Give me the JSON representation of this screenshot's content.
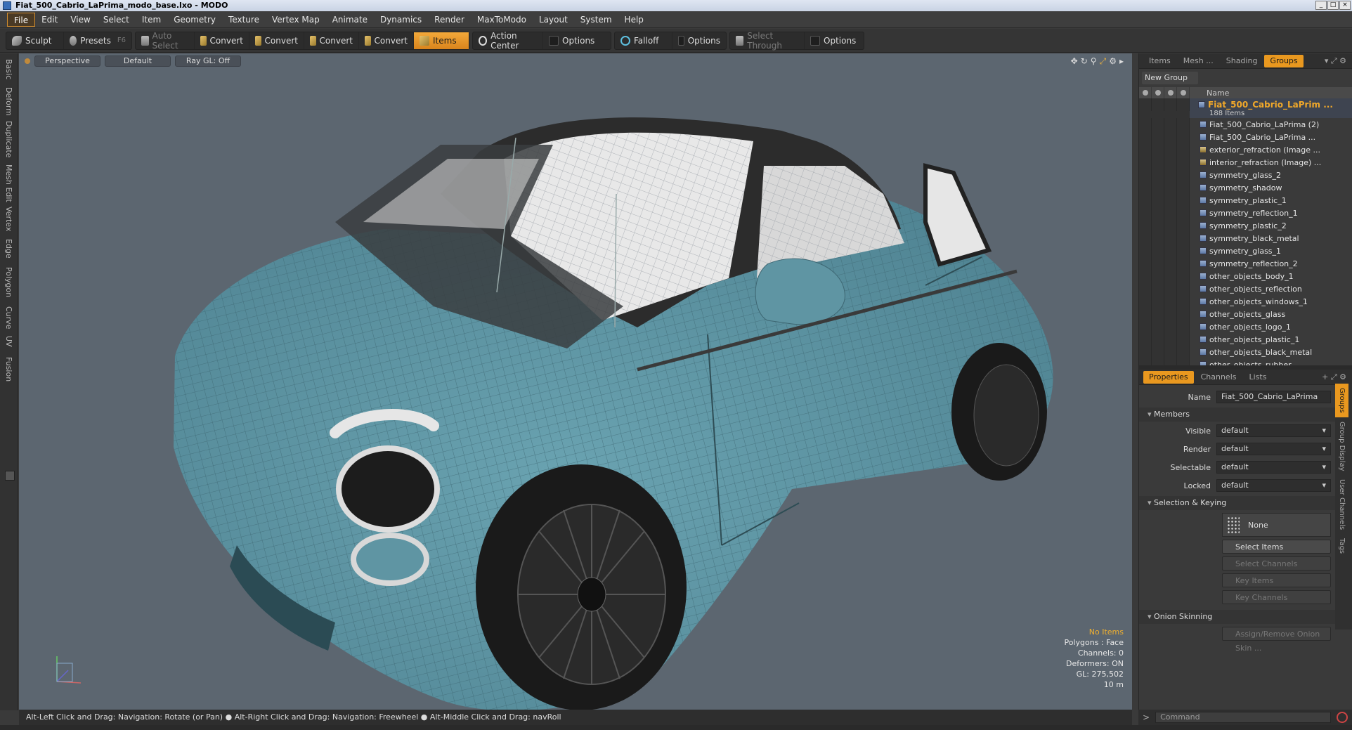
{
  "window": {
    "title": "Fiat_500_Cabrio_LaPrima_modo_base.lxo - MODO"
  },
  "menu": [
    "File",
    "Edit",
    "View",
    "Select",
    "Item",
    "Geometry",
    "Texture",
    "Vertex Map",
    "Animate",
    "Dynamics",
    "Render",
    "MaxToModo",
    "Layout",
    "System",
    "Help"
  ],
  "toolbar": {
    "sculpt": "Sculpt",
    "presets": "Presets",
    "presets_shortcut": "F6",
    "auto_select": "Auto Select",
    "convert1": "Convert",
    "convert2": "Convert",
    "convert3": "Convert",
    "convert4": "Convert",
    "items": "Items",
    "action_center": "Action Center",
    "options1": "Options",
    "falloff": "Falloff",
    "options2": "Options",
    "select_through": "Select Through",
    "options3": "Options"
  },
  "left_tabs": [
    "Basic",
    "Deform",
    "Duplicate",
    "Mesh Edit",
    "Vertex",
    "Edge",
    "Polygon",
    "Curve",
    "UV",
    "Fusion"
  ],
  "viewport": {
    "view": "Perspective",
    "shading": "Default",
    "raygl": "Ray GL: Off",
    "stats": {
      "items": "No Items",
      "polygons": "Polygons : Face",
      "channels": "Channels: 0",
      "deformers": "Deformers: ON",
      "gl": "GL: 275,502",
      "scale": "10 m"
    }
  },
  "status": "Alt-Left Click and Drag: Navigation: Rotate (or Pan) ● Alt-Right Click and Drag: Navigation: Freewheel ● Alt-Middle Click and Drag: navRoll",
  "panel_top": {
    "tabs": [
      "Items",
      "Mesh ...",
      "Shading",
      "Groups"
    ],
    "active_tab": "Groups",
    "new_group": "New Group",
    "name_header": "Name",
    "group": {
      "name": "Fiat_500_Cabrio_LaPrim ...",
      "count": "188 Items"
    },
    "items": [
      "Fiat_500_Cabrio_LaPrima (2)",
      "Fiat_500_Cabrio_LaPrima ...",
      "exterior_refraction (Image ...",
      "interior_refraction (Image) ...",
      "symmetry_glass_2",
      "symmetry_shadow",
      "symmetry_plastic_1",
      "symmetry_reflection_1",
      "symmetry_plastic_2",
      "symmetry_black_metal",
      "symmetry_glass_1",
      "symmetry_reflection_2",
      "other_objects_body_1",
      "other_objects_reflection",
      "other_objects_windows_1",
      "other_objects_glass",
      "other_objects_logo_1",
      "other_objects_plastic_1",
      "other_objects_black_metal",
      "other_objects_rubber"
    ]
  },
  "panel_props": {
    "tabs": [
      "Properties",
      "Channels",
      "Lists"
    ],
    "name_label": "Name",
    "name_value": "Fiat_500_Cabrio_LaPrima",
    "members": "Members",
    "visible_label": "Visible",
    "visible_value": "default",
    "render_label": "Render",
    "render_value": "default",
    "selectable_label": "Selectable",
    "selectable_value": "default",
    "locked_label": "Locked",
    "locked_value": "default",
    "selection_keying": "Selection & Keying",
    "none": "None",
    "select_items": "Select Items",
    "select_channels": "Select Channels",
    "key_items": "Key Items",
    "key_channels": "Key Channels",
    "onion": "Onion Skinning",
    "onion_btn": "Assign/Remove Onion Skin ...",
    "vtabs": [
      "Groups",
      "Group Display",
      "User Channels",
      "Tags"
    ]
  },
  "command": {
    "placeholder": "Command"
  },
  "colors": {
    "accent": "#e9981f",
    "viewport_bg": "#5c6670",
    "car_body": "#5f95a3"
  }
}
